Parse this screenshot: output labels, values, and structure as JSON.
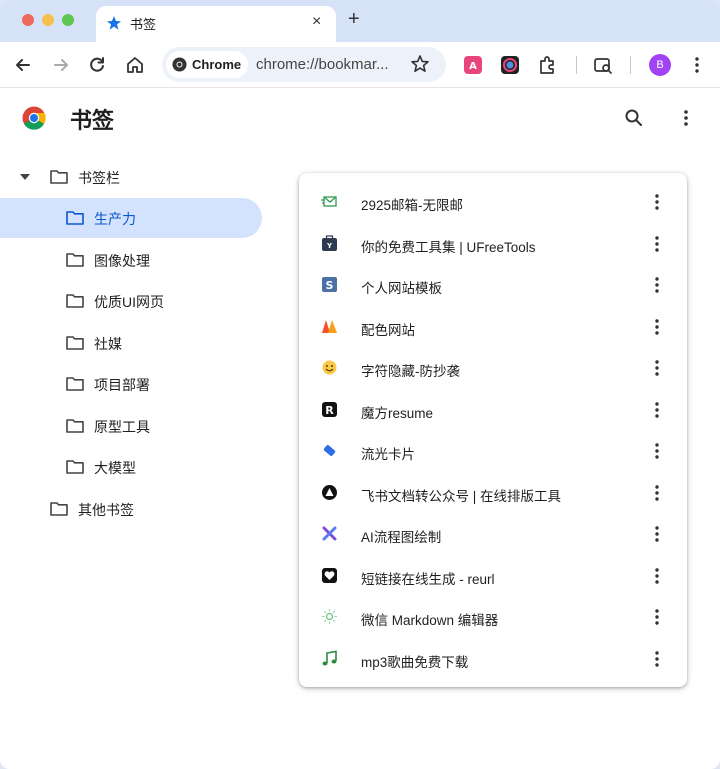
{
  "tab": {
    "title": "书签",
    "close": "×",
    "new_tab": "+"
  },
  "toolbar": {
    "chip_label": "Chrome",
    "url": "chrome://bookmar...",
    "profile_initial": "B"
  },
  "page": {
    "title": "书签"
  },
  "sidebar": {
    "root": "书签栏",
    "children": [
      "生产力",
      "图像处理",
      "优质UI网页",
      "社媒",
      "项目部署",
      "原型工具",
      "大模型"
    ],
    "other": "其他书签"
  },
  "bookmarks": [
    {
      "label": "2925邮箱-无限邮",
      "icon": "mail-icon"
    },
    {
      "label": "你的免费工具集 | UFreeTools",
      "icon": "toolbox-icon"
    },
    {
      "label": "个人网站模板",
      "icon": "s-logo-icon"
    },
    {
      "label": "配色网站",
      "icon": "palette-logo-icon"
    },
    {
      "label": "字符隐藏-防抄袭",
      "icon": "smiley-icon"
    },
    {
      "label": "魔方resume",
      "icon": "r-logo-icon"
    },
    {
      "label": "流光卡片",
      "icon": "card-logo-icon"
    },
    {
      "label": "飞书文档转公众号 | 在线排版工具",
      "icon": "triangle-logo-icon"
    },
    {
      "label": "AI流程图绘制",
      "icon": "flow-logo-icon"
    },
    {
      "label": "短链接在线生成 - reurl",
      "icon": "heart-logo-icon"
    },
    {
      "label": "微信 Markdown 编辑器",
      "icon": "sun-logo-icon"
    },
    {
      "label": "mp3歌曲免费下载",
      "icon": "music-note-icon"
    }
  ],
  "colors": {
    "accent": "#0b57d0",
    "selected_bg": "#d3e3fd",
    "tabstrip": "#d6e2f7",
    "omnibox": "#edf2fa"
  }
}
